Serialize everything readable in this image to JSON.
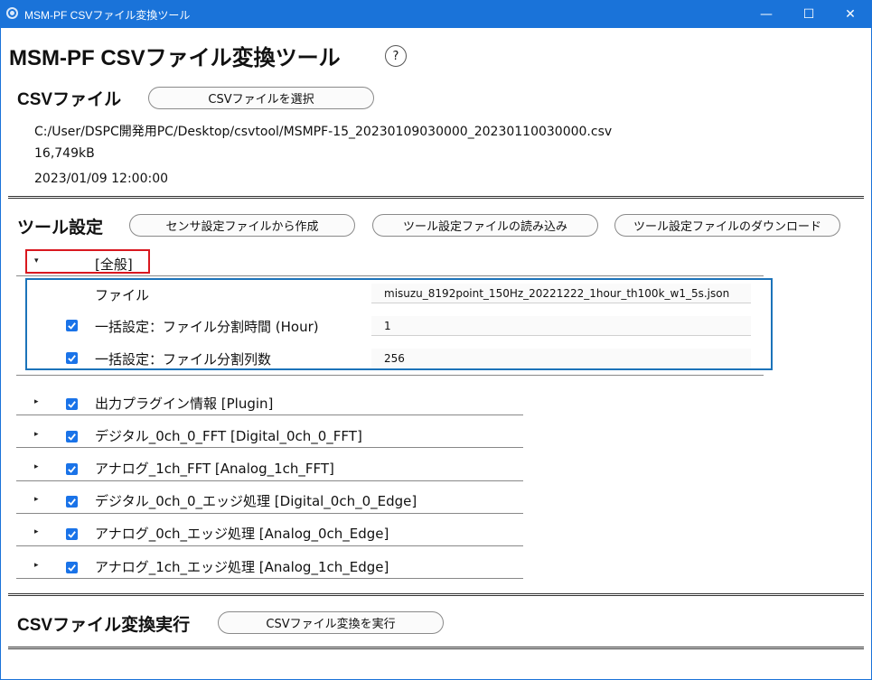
{
  "window": {
    "title": "MSM-PF CSVファイル変換ツール",
    "min_glyph": "—",
    "max_glyph": "☐",
    "close_glyph": "✕"
  },
  "app": {
    "title": "MSM-PF CSVファイル変換ツール",
    "help_glyph": "?"
  },
  "csv_section": {
    "title": "CSVファイル",
    "select_button": "CSVファイルを選択",
    "file_path": "C:/User/DSPC開発用PC/Desktop/csvtool/MSMPF-15_20230109030000_20230110030000.csv",
    "file_size": "16,749kB",
    "file_date": "2023/01/09 12:00:00"
  },
  "tool_settings": {
    "title": "ツール設定",
    "create_from_sensor_button": "センサ設定ファイルから作成",
    "load_settings_button": "ツール設定ファイルの読み込み",
    "download_settings_button": "ツール設定ファイルのダウンロード",
    "general": {
      "label": "[全般]",
      "expanded_glyph": "▾",
      "rows": [
        {
          "label": "ファイル",
          "value": "misuzu_8192point_150Hz_20221222_1hour_th100k_w1_5s.json",
          "checked": false
        },
        {
          "label": "一括設定：ファイル分割時間 (Hour)",
          "value": "1",
          "checked": true
        },
        {
          "label": "一括設定：ファイル分割列数",
          "value": "256",
          "checked": true
        }
      ]
    },
    "collapsed_glyph": "▸",
    "items": [
      {
        "label": "出力プラグイン情報 [Plugin]",
        "checked": true
      },
      {
        "label": "デジタル_0ch_0_FFT [Digital_0ch_0_FFT]",
        "checked": true
      },
      {
        "label": "アナログ_1ch_FFT [Analog_1ch_FFT]",
        "checked": true
      },
      {
        "label": "デジタル_0ch_0_エッジ処理 [Digital_0ch_0_Edge]",
        "checked": true
      },
      {
        "label": "アナログ_0ch_エッジ処理 [Analog_0ch_Edge]",
        "checked": true
      },
      {
        "label": "アナログ_1ch_エッジ処理 [Analog_1ch_Edge]",
        "checked": true
      }
    ]
  },
  "convert_section": {
    "title": "CSVファイル変換実行",
    "run_button": "CSVファイル変換を実行"
  },
  "colors": {
    "titlebar": "#1a73d9",
    "checkbox": "#1a73e8",
    "highlight_red": "#d9181f",
    "highlight_blue": "#1c73b9"
  }
}
